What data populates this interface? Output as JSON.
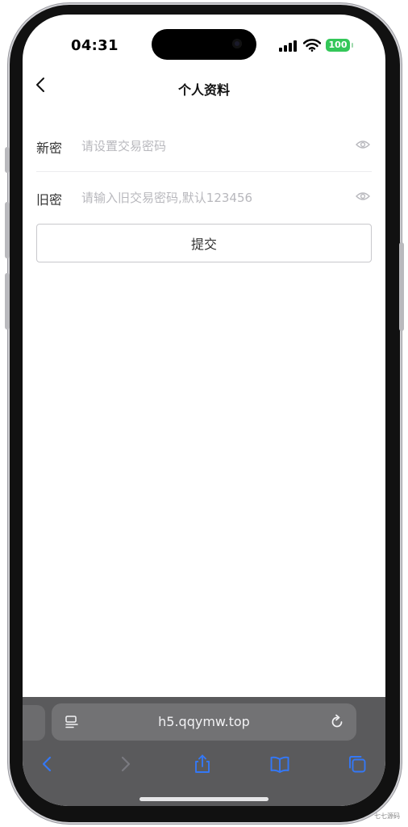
{
  "status_bar": {
    "time": "04:31",
    "battery": "100",
    "battery_color": "#34c759"
  },
  "header": {
    "title": "个人资料",
    "back_icon": "chevron-left-icon"
  },
  "form": {
    "new_password": {
      "label": "新密",
      "placeholder": "请设置交易密码",
      "value": "",
      "icon": "eye-icon"
    },
    "old_password": {
      "label": "旧密",
      "placeholder": "请输入旧交易密码,默认123456",
      "value": "",
      "icon": "eye-icon"
    },
    "submit_label": "提交"
  },
  "browser": {
    "url": "h5.qqymw.top",
    "menu_icon": "page-menu-icon",
    "reload_icon": "reload-icon",
    "toolbar": [
      "back-icon",
      "forward-icon",
      "share-icon",
      "bookmarks-icon",
      "tabs-icon"
    ],
    "accent_color": "#3478f6"
  },
  "watermark": "七七源码"
}
